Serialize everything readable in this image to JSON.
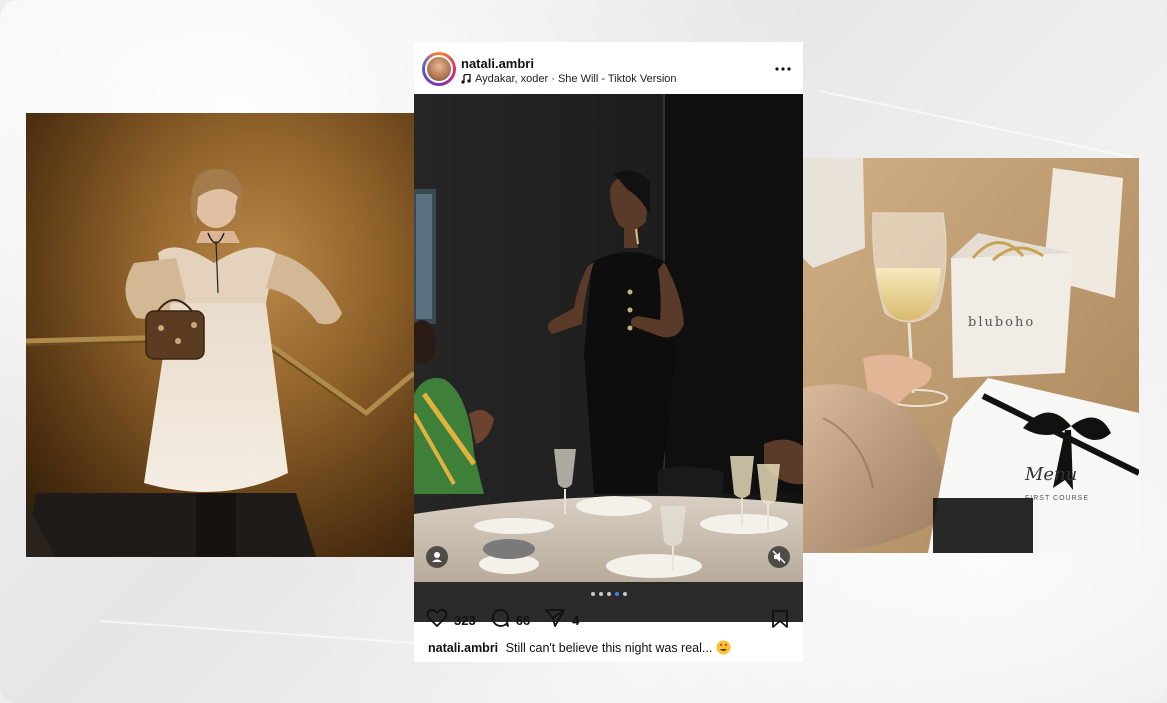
{
  "post": {
    "username": "natali.ambri",
    "audio": "Aydakar, xoder · She Will - Tiktok Version",
    "likes": "323",
    "comments": "66",
    "shares": "4",
    "caption_user": "natali.ambri",
    "caption_text": "Still can't believe this night was real...",
    "carousel": {
      "count": 5,
      "active_index": 3
    }
  },
  "photo_right": {
    "bag_brand": "bluboho",
    "menu_title": "Menu",
    "menu_line": "FIRST COURSE"
  },
  "icons": {
    "music": "music-note-icon",
    "more": "more-icon",
    "like": "heart-icon",
    "comment": "comment-icon",
    "share": "share-icon",
    "save": "bookmark-icon",
    "user_tag": "user-tag-icon",
    "mute": "mute-icon",
    "emoji": "heart-eyes-emoji"
  },
  "colors": {
    "gold_wall": "#8a5a25",
    "accent_blue": "#3b82f6"
  }
}
